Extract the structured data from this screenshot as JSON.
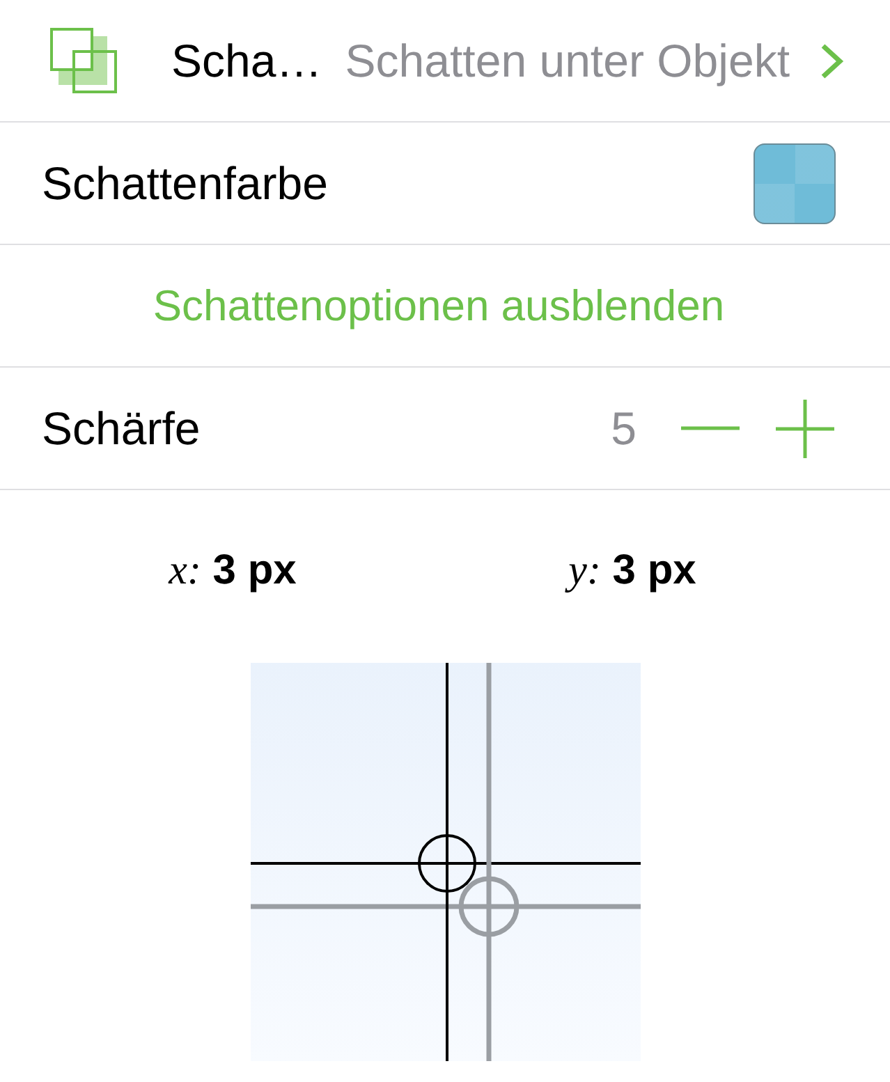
{
  "shadow_style": {
    "title": "Scha…",
    "value": "Schatten unter Objekt"
  },
  "shadow_color": {
    "label": "Schattenfarbe",
    "color": "#6fbcd8"
  },
  "options_toggle": {
    "label": "Schattenoptionen ausblenden"
  },
  "sharpness": {
    "label": "Schärfe",
    "value": "5"
  },
  "offset": [
    {
      "label": "*x:* 3 px"
    },
    {
      "label": "*y:* 3 px"
    }
  ]
}
